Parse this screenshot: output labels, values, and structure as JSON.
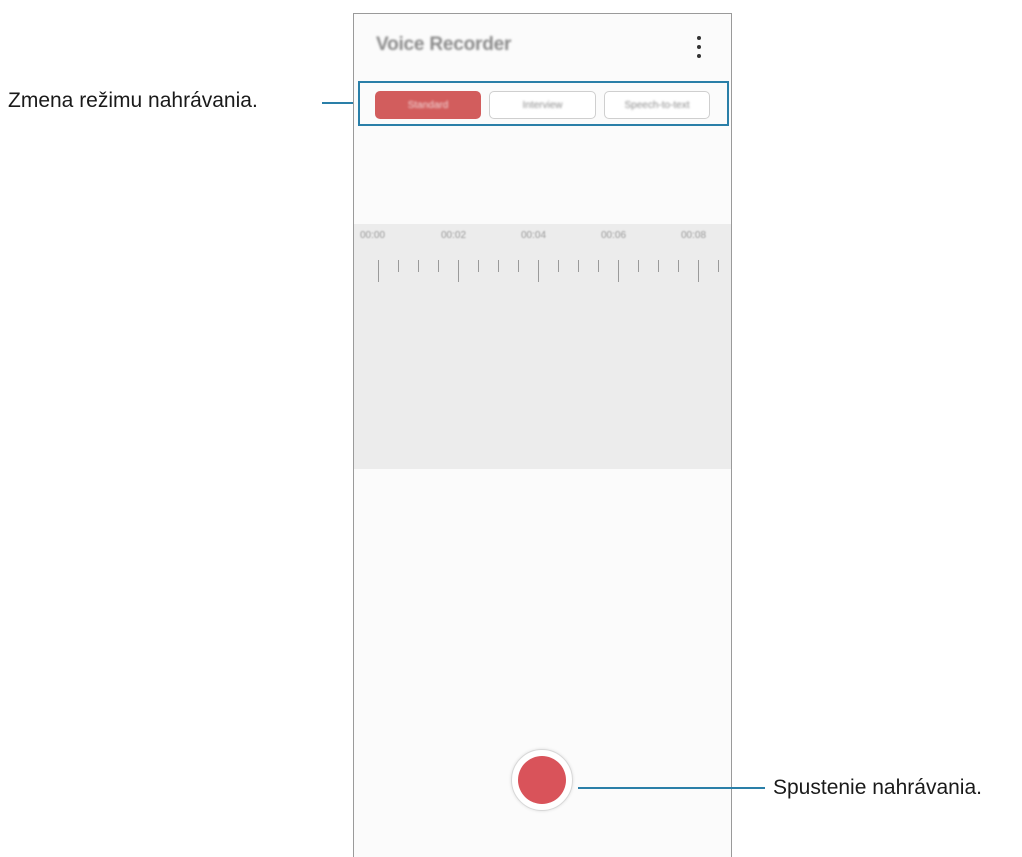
{
  "app": {
    "title": "Voice Recorder"
  },
  "modes": {
    "standard": "Standard",
    "interview": "Interview",
    "speech_to_text": "Speech-to-text",
    "selected": "Standard"
  },
  "timeline": {
    "labels": [
      "00:00",
      "00:02",
      "00:04",
      "00:06",
      "00:08"
    ]
  },
  "callouts": {
    "mode_change": "Zmena režimu nahrávania.",
    "start_recording": "Spustenie nahrávania."
  },
  "colors": {
    "accent": "#d9535a",
    "callout_line": "#2a7fa8"
  },
  "icons": {
    "more": "more-options-icon",
    "record": "record-icon"
  }
}
